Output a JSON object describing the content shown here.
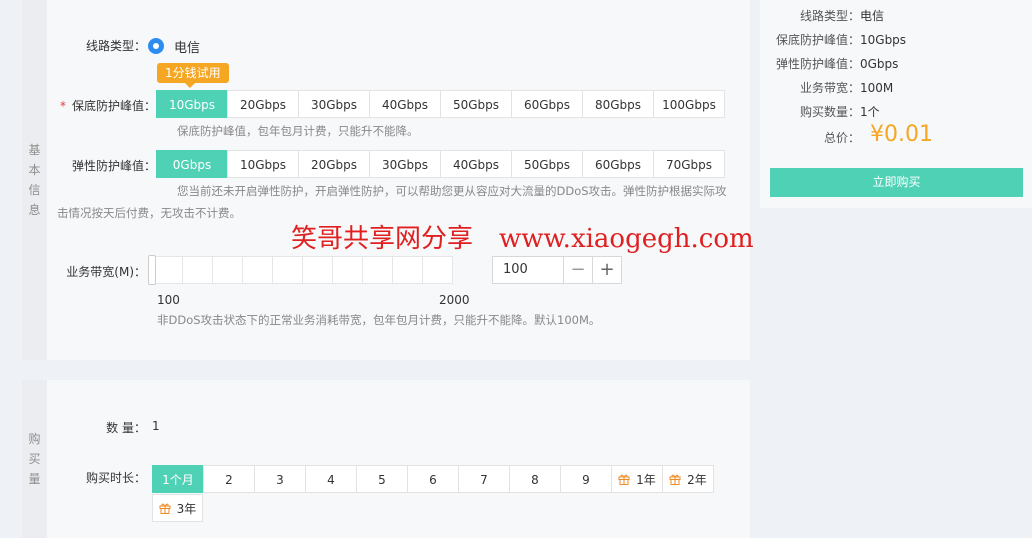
{
  "basic_section": {
    "side_label": [
      "基",
      "本",
      "信",
      "息"
    ],
    "line_type": {
      "label": "线路类型：",
      "value": "电信"
    },
    "promo_badge": "1分钱试用",
    "guarantee": {
      "required_mark": "*",
      "label": "保底防护峰值：",
      "options": [
        "10Gbps",
        "20Gbps",
        "30Gbps",
        "40Gbps",
        "50Gbps",
        "60Gbps",
        "80Gbps",
        "100Gbps"
      ],
      "selected_index": 0,
      "hint": "保底防护峰值，包年包月计费，只能升不能降。"
    },
    "elastic": {
      "label": "弹性防护峰值：",
      "options": [
        "0Gbps",
        "10Gbps",
        "20Gbps",
        "30Gbps",
        "40Gbps",
        "50Gbps",
        "60Gbps",
        "70Gbps"
      ],
      "selected_index": 0,
      "hint_line1": "您当前还未开启弹性防护，开启弹性防护，可以帮助您更从容应对大流量的DDoS攻击。弹性防护根据实际攻",
      "hint_line2": "击情况按天后付费，无攻击不计费。"
    },
    "bandwidth": {
      "label": "业务带宽(M)：",
      "min_label": "100",
      "max_label": "2000",
      "value": "100",
      "minus": "−",
      "plus": "+",
      "hint": "非DDoS攻击状态下的正常业务消耗带宽，包年包月计费，只能升不能降。默认100M。"
    }
  },
  "purchase_section": {
    "side_label": [
      "购",
      "买",
      "量"
    ],
    "quantity": {
      "label": "数 量：",
      "value": "1"
    },
    "duration": {
      "label": "购买时长：",
      "options": [
        "1个月",
        "2",
        "3",
        "4",
        "5",
        "6",
        "7",
        "8",
        "9",
        "1年",
        "2年",
        "3年"
      ],
      "selected_index": 0
    }
  },
  "summary": {
    "rows": [
      {
        "k": "线路类型：",
        "v": "电信"
      },
      {
        "k": "保底防护峰值：",
        "v": "10Gbps"
      },
      {
        "k": "弹性防护峰值：",
        "v": "0Gbps"
      },
      {
        "k": "业务带宽：",
        "v": "100M"
      },
      {
        "k": "购买数量：",
        "v": "1个"
      }
    ],
    "total_label": "总价：",
    "total_value": "¥0.01",
    "buy_button": "立即购买"
  },
  "watermark": "笑哥共享网分享　www.xiaogegh.com",
  "colors": {
    "accent": "#4fd1b5",
    "price": "#f5a623",
    "promo": "#f5a623",
    "radio": "#2d8cf0",
    "watermark": "#e02020"
  }
}
